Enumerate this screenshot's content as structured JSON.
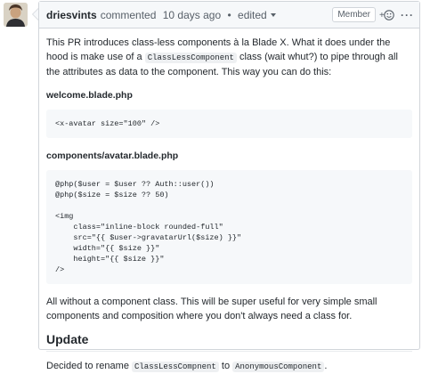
{
  "comment": {
    "author": "driesvints",
    "action": "commented",
    "time": "10 days ago",
    "separator": "•",
    "edited": "edited",
    "role_badge": "Member",
    "more": "···"
  },
  "body": {
    "intro_before": "This PR introduces class-less components à la Blade X. What it does under the hood is make use of a ",
    "intro_code": "ClassLessComponent",
    "intro_after": " class (wait whut?) to pipe through all the attributes as data to the component. This way you can do this:",
    "file1": "welcome.blade.php",
    "code1": "<x-avatar size=\"100\" />",
    "file2": "components/avatar.blade.php",
    "code2": "@php($user = $user ?? Auth::user())\n@php($size = $size ?? 50)\n\n<img\n    class=\"inline-block rounded-full\"\n    src=\"{{ $user->gravatarUrl($size) }}\"\n    width=\"{{ $size }}\"\n    height=\"{{ $size }}\"\n/>",
    "closing": "All without a component class. This will be super useful for very simple small components and composition where you don't always need a class for.",
    "update_heading": "Update",
    "update_before": "Decided to rename ",
    "update_code1": "ClassLessCompnent",
    "update_mid": " to ",
    "update_code2": "AnonymousComponent",
    "update_after": "."
  },
  "icons": {
    "avatar": "author-avatar",
    "emoji": "add-reaction-icon",
    "more": "more-options-icon"
  }
}
